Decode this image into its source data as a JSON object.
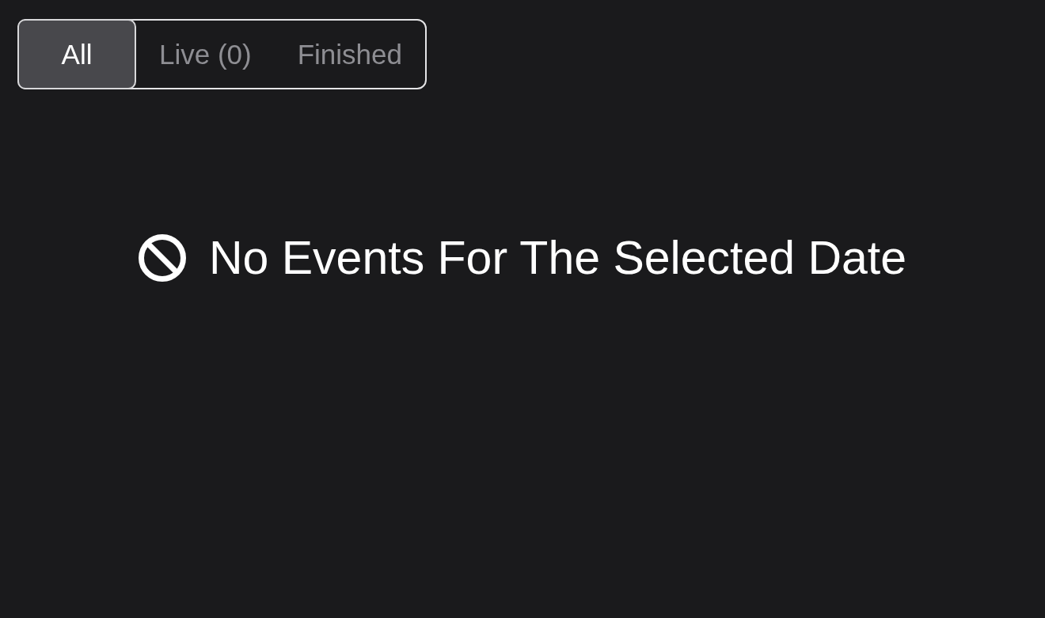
{
  "filter_tabs": [
    {
      "label": "All",
      "selected": true
    },
    {
      "label": "Live (0)",
      "selected": false
    },
    {
      "label": "Finished",
      "selected": false
    }
  ],
  "empty_state": {
    "message": "No Events For The Selected Date"
  }
}
